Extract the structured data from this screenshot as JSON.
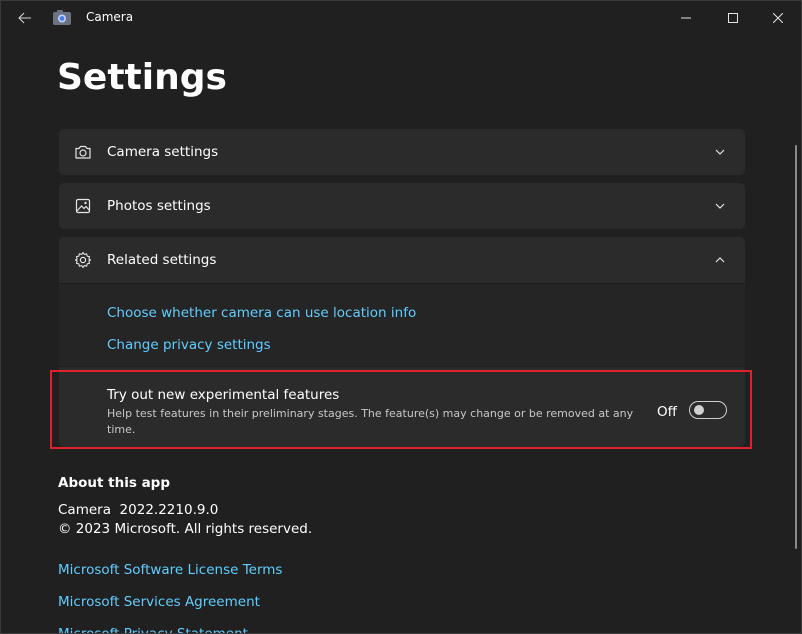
{
  "titlebar": {
    "app_title": "Camera",
    "back_icon": "back-arrow-icon",
    "app_icon": "camera-app-icon",
    "minimize_icon": "minimize-icon",
    "maximize_icon": "maximize-icon",
    "close_icon": "close-icon"
  },
  "page": {
    "title": "Settings"
  },
  "sections": {
    "camera": {
      "label": "Camera settings",
      "icon": "camera-icon",
      "expanded": false
    },
    "photos": {
      "label": "Photos settings",
      "icon": "image-icon",
      "expanded": false
    },
    "related": {
      "label": "Related settings",
      "icon": "gear-icon",
      "expanded": true,
      "links": [
        "Choose whether camera can use location info",
        "Change privacy settings"
      ]
    }
  },
  "experimental": {
    "title": "Try out new experimental features",
    "description": "Help test features in their preliminary stages. The feature(s) may change or be removed at any time.",
    "toggle_state": "Off",
    "enabled": false
  },
  "about": {
    "heading": "About this app",
    "version_line": "Camera  2022.2210.9.0",
    "copyright": "© 2023 Microsoft. All rights reserved.",
    "links": [
      "Microsoft Software License Terms",
      "Microsoft Services Agreement",
      "Microsoft Privacy Statement"
    ]
  },
  "colors": {
    "background": "#202020",
    "card": "#2b2b2b",
    "link": "#60cdff",
    "highlight": "#e0202d"
  }
}
